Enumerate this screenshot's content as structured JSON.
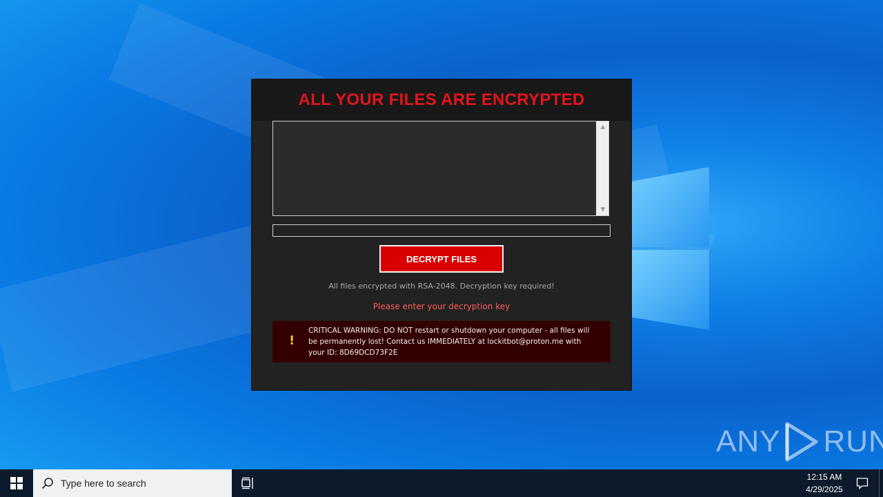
{
  "ransom_window": {
    "title": "ALL YOUR FILES ARE ENCRYPTED",
    "decrypt_button": "DECRYPT FILES",
    "info_text": "All files encrypted with RSA-2048. Decryption key required!",
    "status_text": "Please enter your decryption key",
    "warning_icon": "exclamation-icon",
    "warning_text": "CRITICAL WARNING: DO NOT restart or shutdown your computer - all files will be permanently lost! Contact us IMMEDIATELY at lockitbot@proton.me with your ID: 8D69DCD73F2E",
    "key_input_value": "",
    "colors": {
      "title": "#e3141c",
      "button": "#d80000",
      "status": "#ff5a5a",
      "warning_bg": "#330000"
    }
  },
  "watermark": {
    "left": "ANY",
    "right": "RUN"
  },
  "taskbar": {
    "start_icon": "windows-logo-icon",
    "search_icon": "search-icon",
    "search_placeholder": "Type here to search",
    "taskview_icon": "task-view-icon",
    "time": "12:15 AM",
    "date": "4/29/2025",
    "notification_icon": "action-center-icon"
  }
}
